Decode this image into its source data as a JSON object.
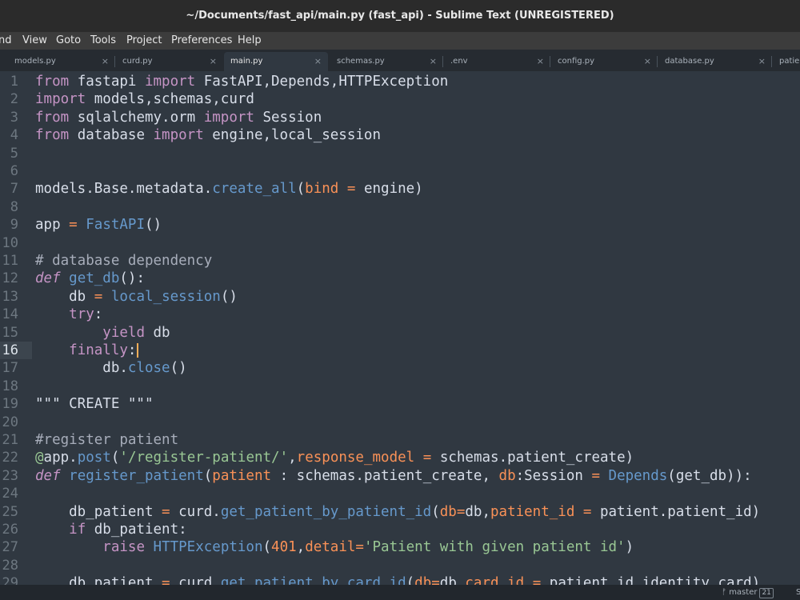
{
  "window": {
    "title": "~/Documents/fast_api/main.py (fast_api) - Sublime Text (UNREGISTERED)"
  },
  "menu": [
    "nd",
    "View",
    "Goto",
    "Tools",
    "Project",
    "Preferences",
    "Help"
  ],
  "tabs": [
    {
      "label": "models.py",
      "close": "×"
    },
    {
      "label": "curd.py",
      "close": "×"
    },
    {
      "label": "main.py",
      "close": "×",
      "active": true
    },
    {
      "label": "schemas.py",
      "close": "×"
    },
    {
      "label": ".env",
      "close": "×"
    },
    {
      "label": "config.py",
      "close": "×"
    },
    {
      "label": "database.py",
      "close": "×"
    },
    {
      "label": "patie",
      "close": ""
    }
  ],
  "editor": {
    "current_line": 16,
    "lines": [
      {
        "n": "1",
        "tokens": [
          [
            "k",
            "from"
          ],
          [
            "t",
            " fastapi "
          ],
          [
            "k",
            "import"
          ],
          [
            "t",
            " FastAPI,Depends,HTTPException"
          ]
        ]
      },
      {
        "n": "2",
        "tokens": [
          [
            "k",
            "import"
          ],
          [
            "t",
            " models,schemas,curd"
          ]
        ]
      },
      {
        "n": "3",
        "tokens": [
          [
            "k",
            "from"
          ],
          [
            "t",
            " sqlalchemy.orm "
          ],
          [
            "k",
            "import"
          ],
          [
            "t",
            " Session"
          ]
        ]
      },
      {
        "n": "4",
        "tokens": [
          [
            "k",
            "from"
          ],
          [
            "t",
            " database "
          ],
          [
            "k",
            "import"
          ],
          [
            "t",
            " engine,local_session"
          ]
        ]
      },
      {
        "n": "5",
        "tokens": []
      },
      {
        "n": "6",
        "tokens": []
      },
      {
        "n": "7",
        "tokens": [
          [
            "t",
            "models.Base.metadata."
          ],
          [
            "f",
            "create_all"
          ],
          [
            "t",
            "("
          ],
          [
            "o",
            "bind"
          ],
          [
            "t",
            " "
          ],
          [
            "o",
            "="
          ],
          [
            "t",
            " engine)"
          ]
        ]
      },
      {
        "n": "8",
        "tokens": []
      },
      {
        "n": "9",
        "tokens": [
          [
            "t",
            "app "
          ],
          [
            "o",
            "="
          ],
          [
            "t",
            " "
          ],
          [
            "f",
            "FastAPI"
          ],
          [
            "t",
            "()"
          ]
        ]
      },
      {
        "n": "10",
        "tokens": []
      },
      {
        "n": "11",
        "tokens": [
          [
            "c",
            "# database dependency"
          ]
        ]
      },
      {
        "n": "12",
        "tokens": [
          [
            "kd",
            "def"
          ],
          [
            "t",
            " "
          ],
          [
            "f",
            "get_db"
          ],
          [
            "t",
            "():"
          ]
        ]
      },
      {
        "n": "13",
        "tokens": [
          [
            "t",
            "    db "
          ],
          [
            "o",
            "="
          ],
          [
            "t",
            " "
          ],
          [
            "f",
            "local_session"
          ],
          [
            "t",
            "()"
          ]
        ]
      },
      {
        "n": "14",
        "tokens": [
          [
            "t",
            "    "
          ],
          [
            "k",
            "try"
          ],
          [
            "t",
            ":"
          ]
        ]
      },
      {
        "n": "15",
        "tokens": [
          [
            "t",
            "        "
          ],
          [
            "k",
            "yield"
          ],
          [
            "t",
            " db"
          ]
        ]
      },
      {
        "n": "16",
        "tokens": [
          [
            "t",
            "    "
          ],
          [
            "k",
            "finally"
          ],
          [
            "t",
            ":"
          ]
        ],
        "cursor": true
      },
      {
        "n": "17",
        "tokens": [
          [
            "t",
            "        db."
          ],
          [
            "f",
            "close"
          ],
          [
            "t",
            "()"
          ]
        ]
      },
      {
        "n": "18",
        "tokens": []
      },
      {
        "n": "19",
        "tokens": [
          [
            "t",
            "\"\"\" CREATE \"\"\""
          ]
        ]
      },
      {
        "n": "20",
        "tokens": []
      },
      {
        "n": "21",
        "tokens": [
          [
            "c",
            "#register patient"
          ]
        ]
      },
      {
        "n": "22",
        "tokens": [
          [
            "s",
            "@"
          ],
          [
            "t",
            "app."
          ],
          [
            "f",
            "post"
          ],
          [
            "t",
            "("
          ],
          [
            "s",
            "'/register-patient/'"
          ],
          [
            "t",
            ","
          ],
          [
            "o",
            "response_model"
          ],
          [
            "t",
            " "
          ],
          [
            "o",
            "="
          ],
          [
            "t",
            " schemas.patient_create)"
          ]
        ]
      },
      {
        "n": "23",
        "tokens": [
          [
            "kd",
            "def"
          ],
          [
            "t",
            " "
          ],
          [
            "f",
            "register_patient"
          ],
          [
            "t",
            "("
          ],
          [
            "o",
            "patient"
          ],
          [
            "t",
            " : schemas.patient_create, "
          ],
          [
            "o",
            "db"
          ],
          [
            "t",
            ":Session "
          ],
          [
            "o",
            "="
          ],
          [
            "t",
            " "
          ],
          [
            "f",
            "Depends"
          ],
          [
            "t",
            "(get_db)):"
          ]
        ]
      },
      {
        "n": "24",
        "tokens": []
      },
      {
        "n": "25",
        "tokens": [
          [
            "t",
            "    db_patient "
          ],
          [
            "o",
            "="
          ],
          [
            "t",
            " curd."
          ],
          [
            "f",
            "get_patient_by_patient_id"
          ],
          [
            "t",
            "("
          ],
          [
            "o",
            "db"
          ],
          [
            "o",
            "="
          ],
          [
            "t",
            "db,"
          ],
          [
            "o",
            "patient_id"
          ],
          [
            "t",
            " "
          ],
          [
            "o",
            "="
          ],
          [
            "t",
            " patient.patient_id)"
          ]
        ]
      },
      {
        "n": "26",
        "tokens": [
          [
            "t",
            "    "
          ],
          [
            "k",
            "if"
          ],
          [
            "t",
            " db_patient:"
          ]
        ]
      },
      {
        "n": "27",
        "tokens": [
          [
            "t",
            "        "
          ],
          [
            "k",
            "raise"
          ],
          [
            "t",
            " "
          ],
          [
            "f",
            "HTTPException"
          ],
          [
            "t",
            "("
          ],
          [
            "n",
            "401"
          ],
          [
            "t",
            ","
          ],
          [
            "o",
            "detail"
          ],
          [
            "o",
            "="
          ],
          [
            "s",
            "'Patient with given patient id'"
          ],
          [
            "t",
            ")"
          ]
        ]
      },
      {
        "n": "28",
        "tokens": []
      },
      {
        "n": "29",
        "tokens": [
          [
            "t",
            "    db_patient "
          ],
          [
            "o",
            "="
          ],
          [
            "t",
            " curd."
          ],
          [
            "f",
            "get_patient_by_card_id"
          ],
          [
            "t",
            "("
          ],
          [
            "o",
            "db"
          ],
          [
            "o",
            "="
          ],
          [
            "t",
            "db,"
          ],
          [
            "o",
            "card_id"
          ],
          [
            "t",
            " "
          ],
          [
            "o",
            "="
          ],
          [
            "t",
            " patient_id.identity_card)"
          ]
        ]
      }
    ]
  },
  "status": {
    "branch": "master",
    "count": "21",
    "right": "S"
  },
  "colors": {
    "editor_bg": "#303841",
    "keyword": "#c594c5",
    "function": "#6699cc",
    "param": "#f99157",
    "string": "#99c794",
    "cursor": "#f9ae58"
  }
}
